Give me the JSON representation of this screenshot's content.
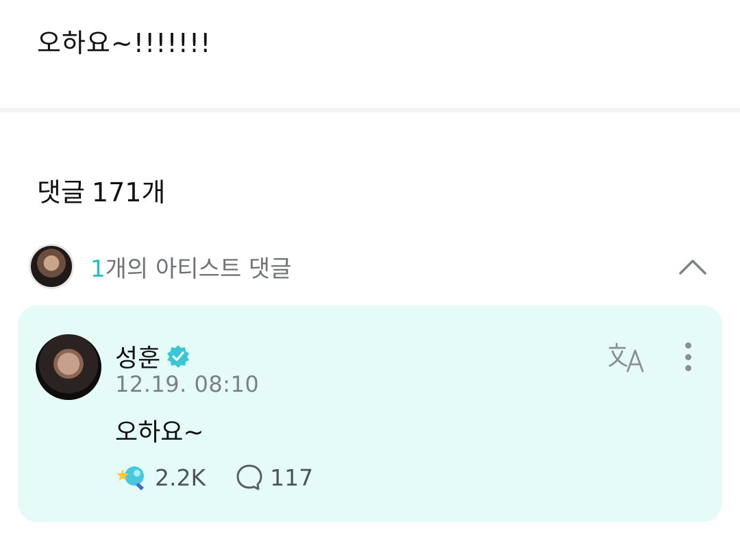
{
  "post": {
    "text": "오하요~!!!!!!!"
  },
  "comments": {
    "label": "댓글",
    "count": "171개"
  },
  "artist_comments": {
    "number": "1",
    "label": "개의 아티스트 댓글"
  },
  "comment": {
    "author": "성훈",
    "timestamp": "12.19. 08:10",
    "body": "오하요~",
    "like_count": "2.2K",
    "reply_count": "117"
  },
  "colors": {
    "accent": "#21c0c0",
    "card_bg": "#e5fbf7",
    "verified": "#39c7d6"
  },
  "icons": [
    "chevron-up-icon",
    "verified-badge-icon",
    "translate-icon",
    "more-vertical-icon",
    "like-reaction-icon",
    "reply-bubble-icon"
  ]
}
